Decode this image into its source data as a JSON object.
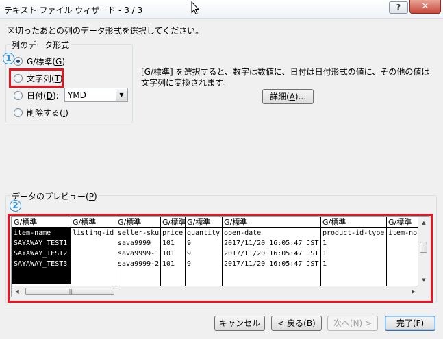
{
  "window": {
    "title": "テキスト ファイル ウィザード - 3 / 3",
    "help_label": "?",
    "close_label": "✕"
  },
  "instruction": "区切ったあとの列のデータ形式を選択してください。",
  "column_format": {
    "legend": "列のデータ形式",
    "options": [
      {
        "label": "G/標準(",
        "key": "G",
        "suffix": ")",
        "checked": true
      },
      {
        "label": "文字列(",
        "key": "T",
        "suffix": ")",
        "checked": false
      },
      {
        "label": "日付(",
        "key": "D",
        "suffix": "):",
        "checked": false
      },
      {
        "label": "削除する(",
        "key": "I",
        "suffix": ")",
        "checked": false
      }
    ],
    "date_format": "YMD"
  },
  "badges": {
    "one": "1",
    "two": "2"
  },
  "description": "[G/標準] を選択すると、数字は数値に、日付は日付形式の値に、その他の値は文字列に変換されます。",
  "advanced_button": {
    "label": "詳細(",
    "key": "A",
    "suffix": ")..."
  },
  "preview": {
    "legend_prefix": "データのプレビュー(",
    "legend_key": "P",
    "legend_suffix": ")",
    "columns": [
      {
        "header": "G/標準",
        "cells": [
          "item-name",
          "SAYAWAY_TEST1",
          "SAYAWAY_TEST2",
          "SAYAWAY_TEST3"
        ]
      },
      {
        "header": "G/標準",
        "cells": [
          "listing-id",
          "",
          "",
          ""
        ]
      },
      {
        "header": "G/標準",
        "cells": [
          "seller-sku",
          "sava9999",
          "sava9999-1",
          "sava9999-2"
        ]
      },
      {
        "header": "G/標準",
        "cells": [
          "price",
          "101",
          "101",
          "101"
        ]
      },
      {
        "header": "G/標準",
        "cells": [
          "quantity",
          "9",
          "9",
          "9"
        ]
      },
      {
        "header": "G/標準",
        "cells": [
          "open-date",
          "2017/11/20 16:05:47 JST",
          "2017/11/20 16:05:47 JST",
          "2017/11/20 16:05:47 JST"
        ]
      },
      {
        "header": "G/標準",
        "cells": [
          "product-id-type",
          "1",
          "1",
          "1"
        ]
      },
      {
        "header": "G/標準",
        "cells": [
          "item-not",
          "",
          "",
          ""
        ]
      }
    ]
  },
  "footer": {
    "cancel": "キャンセル",
    "back": "< 戻る(B)",
    "next": "次へ(N) >",
    "finish": "完了(F)"
  }
}
